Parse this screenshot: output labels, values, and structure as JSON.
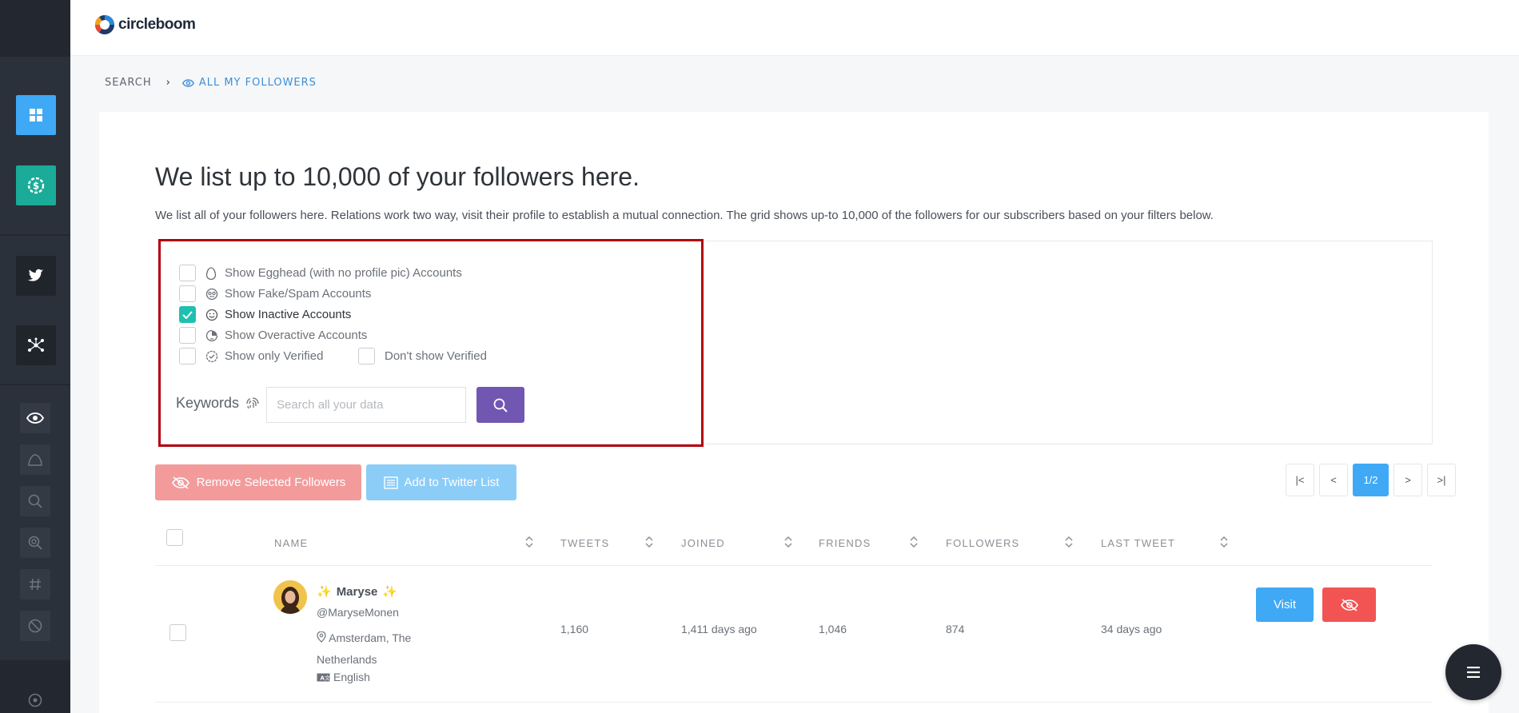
{
  "app": {
    "logo_text": "circleboom"
  },
  "breadcrumb": {
    "root": "SEARCH",
    "current": "ALL MY FOLLOWERS"
  },
  "main": {
    "title": "We list up to 10,000 of your followers here.",
    "description": "We list all of your followers here. Relations work two way, visit their profile to establish a mutual connection. The grid shows up-to 10,000 of the followers for our subscribers based on your filters below."
  },
  "filters": {
    "egghead": {
      "label": "Show Egghead (with no profile pic) Accounts",
      "checked": false,
      "icon": "egg-icon"
    },
    "fake": {
      "label": "Show Fake/Spam Accounts",
      "checked": false,
      "icon": "fake-face-icon"
    },
    "inactive": {
      "label": "Show Inactive Accounts",
      "checked": true,
      "icon": "smile-icon"
    },
    "overactive": {
      "label": "Show Overactive Accounts",
      "checked": false,
      "icon": "overactive-icon"
    },
    "verified_only": {
      "label": "Show only Verified",
      "checked": false,
      "icon": "verified-icon"
    },
    "no_verified": {
      "label": "Don't show Verified",
      "checked": false
    },
    "keywords_label": "Keywords",
    "keywords_placeholder": "Search all your data"
  },
  "actions": {
    "remove_label": "Remove Selected Followers",
    "add_list_label": "Add to Twitter List"
  },
  "pager": {
    "first": "|<",
    "prev": "<",
    "current": "1/2",
    "next": ">",
    "last": ">|"
  },
  "table": {
    "headers": {
      "name": "NAME",
      "tweets": "TWEETS",
      "joined": "JOINED",
      "friends": "FRIENDS",
      "followers": "FOLLOWERS",
      "last_tweet": "LAST TWEET"
    },
    "rows": [
      {
        "name": "Maryse",
        "handle": "@MaryseMonen",
        "location": "Amsterdam, The Netherlands",
        "language": "English",
        "tweets": "1,160",
        "joined": "1,411 days ago",
        "friends": "1,046",
        "followers": "874",
        "last_tweet": "34 days ago",
        "visit_label": "Visit"
      }
    ]
  },
  "colors": {
    "accent_blue": "#3fa9f5",
    "teal": "#1aab99",
    "purple": "#7157b2",
    "danger": "#f25454",
    "highlight_red": "#b3000d"
  }
}
